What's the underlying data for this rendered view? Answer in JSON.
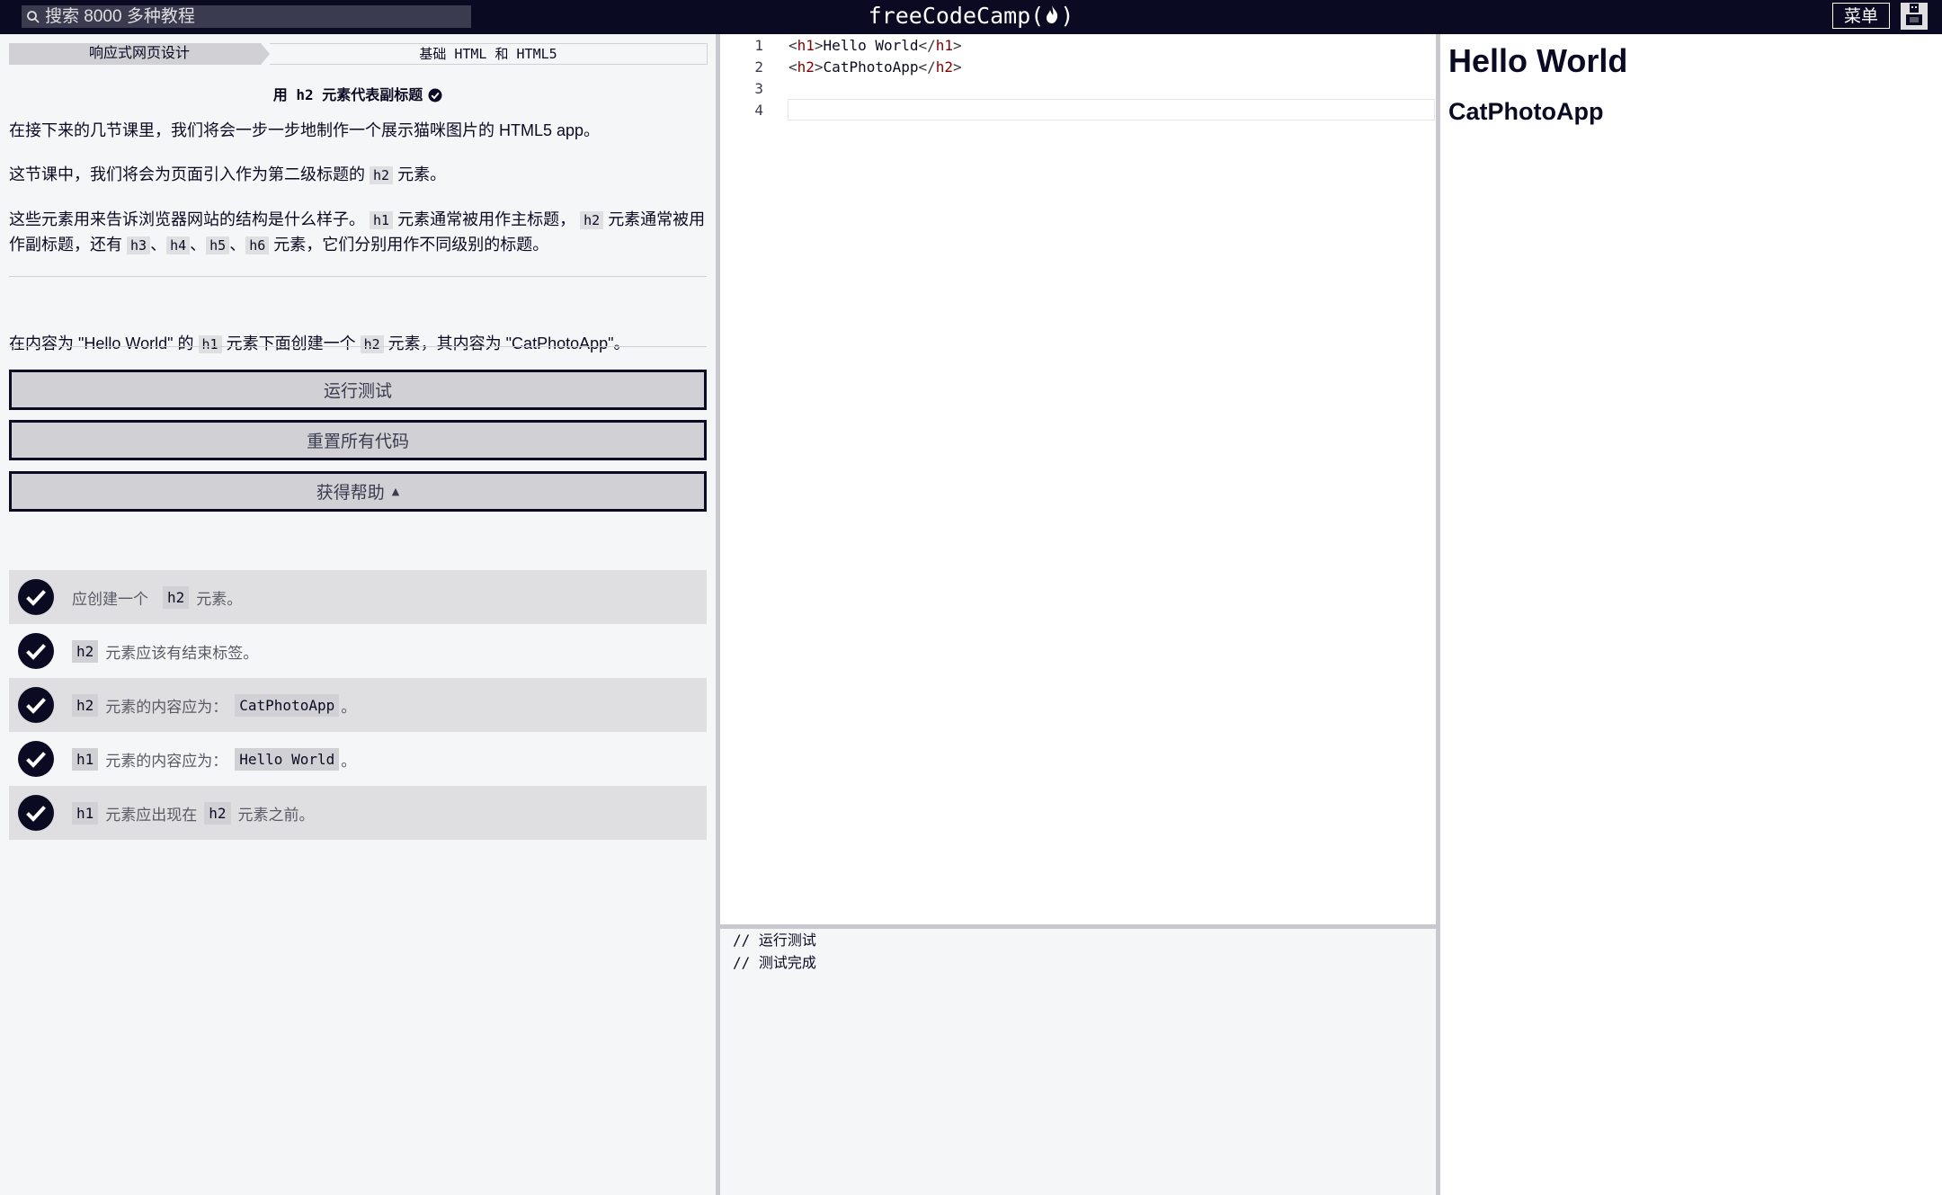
{
  "header": {
    "search_placeholder": "搜索 8000 多种教程",
    "brand": "freeCodeCamp",
    "menu_label": "菜单"
  },
  "breadcrumb": {
    "superblock": "响应式网页设计",
    "block": "基础 HTML 和 HTML5"
  },
  "challenge": {
    "title": "用 h2 元素代表副标题",
    "desc": {
      "p1": "在接下来的几节课里，我们将会一步一步地制作一个展示猫咪图片的 HTML5 app。",
      "p2_a": "这节课中，我们将会为页面引入作为第二级标题的",
      "p2_code": "h2",
      "p2_b": "元素。",
      "p3_a": "这些元素用来告诉浏览器网站的结构是什么样子。",
      "p3_c1": "h1",
      "p3_b": "元素通常被用作主标题，",
      "p3_c2": "h2",
      "p3_c": "元素通常被用作副标题，还有",
      "p3_c3": "h3",
      "p3_s1": "、",
      "p3_c4": "h4",
      "p3_s2": "、",
      "p3_c5": "h5",
      "p3_s3": "、",
      "p3_c6": "h6",
      "p3_d": "元素，它们分别用作不同级别的标题。"
    },
    "instructions": {
      "a": "在内容为 \"Hello World\" 的",
      "c1": "h1",
      "b": "元素下面创建一个",
      "c2": "h2",
      "c": "元素，其内容为 \"CatPhotoApp\"。"
    }
  },
  "buttons": {
    "run_tests": "运行测试",
    "reset_code": "重置所有代码",
    "get_help": "获得帮助"
  },
  "tests": [
    {
      "pre": "应创建一个",
      "code": "h2",
      "post": "元素。"
    },
    {
      "code": "h2",
      "post": "元素应该有结束标签。"
    },
    {
      "code": "h2",
      "mid": "元素的内容应为：",
      "code2": "CatPhotoApp",
      "post": "。"
    },
    {
      "code": "h1",
      "mid": "元素的内容应为：",
      "code2": "Hello World",
      "post": "。"
    },
    {
      "code": "h1",
      "mid": "元素应出现在",
      "code2": "h2",
      "post": "元素之前。"
    }
  ],
  "editor": {
    "line_numbers": [
      "1",
      "2",
      "3",
      "4"
    ],
    "line1": {
      "open": "h1",
      "text": "Hello World",
      "close": "h1"
    },
    "line2": {
      "open": "h2",
      "text": "CatPhotoApp",
      "close": "h2"
    }
  },
  "console": {
    "line1": "// 运行测试",
    "line2": "// 测试完成"
  },
  "preview": {
    "h1": "Hello World",
    "h2": "CatPhotoApp"
  }
}
